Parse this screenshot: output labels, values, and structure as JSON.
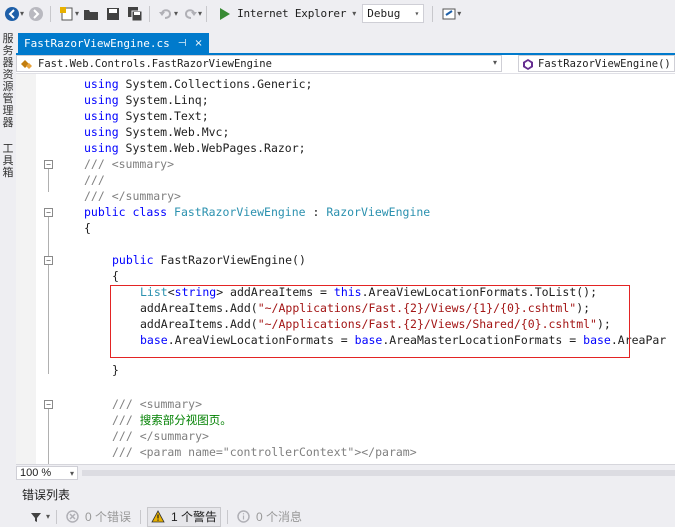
{
  "toolbar": {
    "run_target": "Internet Explorer",
    "configuration": "Debug"
  },
  "side_tabs": [
    "服务器资源管理器",
    "工具箱"
  ],
  "document_tab": {
    "title": "FastRazorViewEngine.cs",
    "pin_glyph": "⊣",
    "close_glyph": "×"
  },
  "navigation": {
    "type_selector": "Fast.Web.Controls.FastRazorViewEngine",
    "member_selector": "FastRazorViewEngine()"
  },
  "code": {
    "l1_kw": "using",
    "l1_rest": " System.Collections.Generic;",
    "l2_kw": "using",
    "l2_rest": " System.Linq;",
    "l3_kw": "using",
    "l3_rest": " System.Text;",
    "l4_kw": "using",
    "l4_rest": " System.Web.Mvc;",
    "l5_kw": "using",
    "l5_rest": " System.Web.WebPages.Razor;",
    "l6_a": "/// ",
    "l6_b": "<summary>",
    "l7": "///",
    "l8_a": "/// ",
    "l8_b": "</summary>",
    "l9_kw1": "public",
    "l9_kw2": " class",
    "l9_name": " FastRazorViewEngine",
    "l9_colon": " : ",
    "l9_base": "RazorViewEngine",
    "l10": "{",
    "l12_kw": "public",
    "l12_rest": " FastRazorViewEngine()",
    "l13": "{",
    "l14_type1": "List",
    "l14_lt": "<",
    "l14_kw1": "string",
    "l14_gt": ">",
    "l14_mid": " addAreaItems = ",
    "l14_kw2": "this",
    "l14_rest": ".AreaViewLocationFormats.ToList();",
    "l15_a": "addAreaItems.Add(",
    "l15_str": "\"~/Applications/Fast.{2}/Views/{1}/{0}.cshtml\"",
    "l15_b": ");",
    "l16_a": "addAreaItems.Add(",
    "l16_str": "\"~/Applications/Fast.{2}/Views/Shared/{0}.cshtml\"",
    "l16_b": ");",
    "l17_kw1": "base",
    "l17_mid": ".AreaViewLocationFormats = ",
    "l17_kw2": "base",
    "l17_mid2": ".AreaMasterLocationFormats = ",
    "l17_kw3": "base",
    "l17_rest": ".AreaPar",
    "l18": "}",
    "l19_a": "/// ",
    "l19_b": "<summary>",
    "l20_a": "/// ",
    "l20_b": "搜索部分视图页。",
    "l21_a": "/// ",
    "l21_b": "</summary>",
    "l22_a": "/// ",
    "l22_b": "<param name=\"controllerContext\"></param>"
  },
  "zoom": "100 %",
  "error_list": {
    "title": "错误列表",
    "errors": "0 个错误",
    "warnings": "1 个警告",
    "messages": "0 个消息"
  },
  "colors": {
    "accent": "#007acc",
    "keyword": "#0000ff",
    "type": "#2b91af",
    "comment": "#008000",
    "string": "#a31515",
    "highlight_box": "#e32424"
  }
}
